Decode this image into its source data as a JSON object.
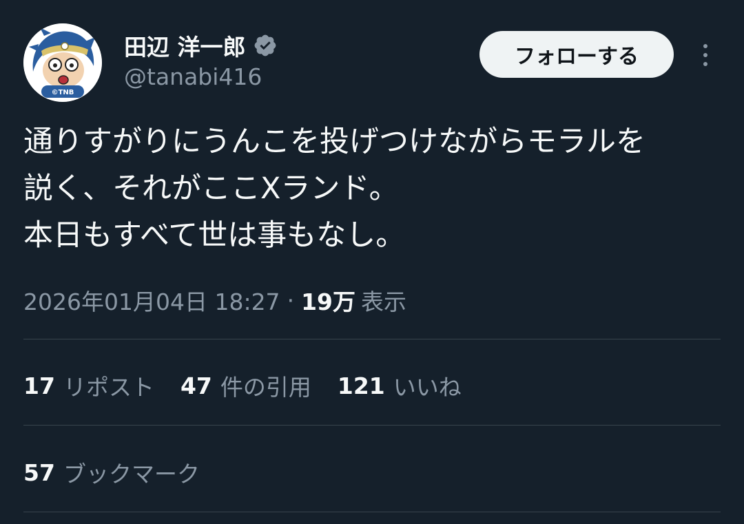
{
  "author": {
    "display_name": "田辺 洋一郎",
    "handle": "@tanabi416",
    "verified": true,
    "avatar_badge": "©TNB"
  },
  "actions": {
    "follow_label": "フォローする",
    "more_icon": "more-vertical-icon"
  },
  "tweet": {
    "text": "通りすがりにうんこを投げつけながらモラルを\n説く、それがここXランド。\n本日もすべて世は事もなし。",
    "timestamp": "2026年01月04日 18:27",
    "separator": "·",
    "views_count": "19万",
    "views_label": "表示"
  },
  "stats": {
    "reposts_count": "17",
    "reposts_label": "リポスト",
    "quotes_count": "47",
    "quotes_label": "件の引用",
    "likes_count": "121",
    "likes_label": "いいね",
    "bookmarks_count": "57",
    "bookmarks_label": "ブックマーク"
  },
  "colors": {
    "background": "#15202b",
    "primary_text": "#f7f9f9",
    "secondary_text": "#8b98a5",
    "divider": "#38444d",
    "verified_badge": "#8b98a5",
    "follow_button_bg": "#eff3f4"
  }
}
